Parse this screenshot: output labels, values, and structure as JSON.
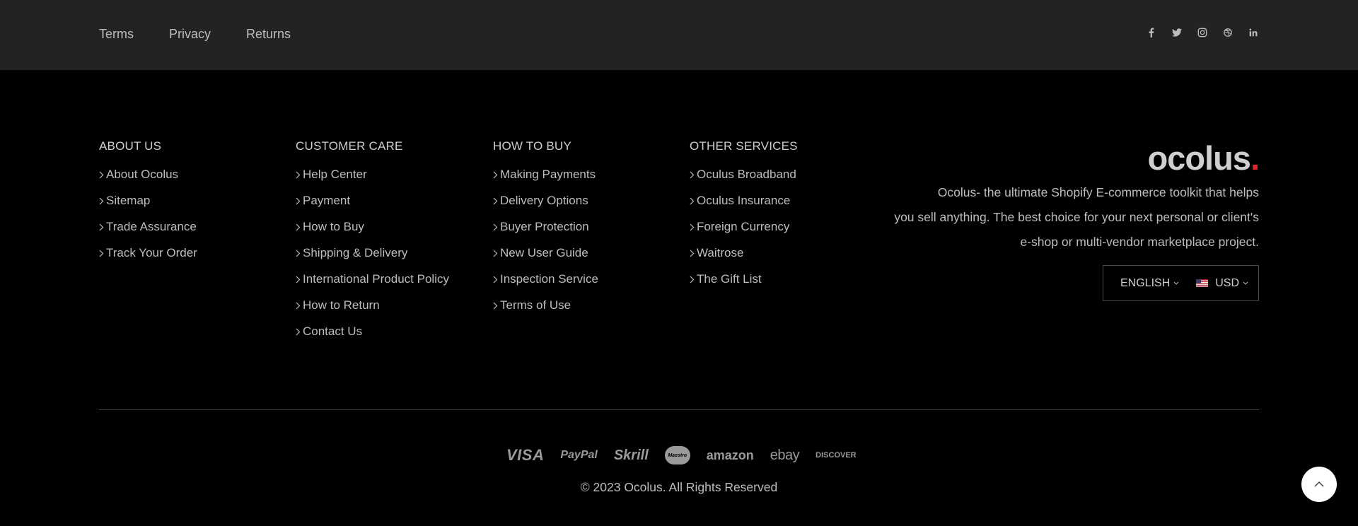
{
  "top_links": [
    "Terms",
    "Privacy",
    "Returns"
  ],
  "social_icons": [
    "facebook-icon",
    "twitter-icon",
    "instagram-icon",
    "dribbble-icon",
    "linkedin-icon"
  ],
  "columns": [
    {
      "heading": "ABOUT US",
      "items": [
        "About Ocolus",
        "Sitemap",
        "Trade Assurance",
        "Track Your Order"
      ]
    },
    {
      "heading": "CUSTOMER CARE",
      "items": [
        "Help Center",
        "Payment",
        "How to Buy",
        "Shipping & Delivery",
        "International Product Policy",
        "How to Return",
        "Contact Us"
      ]
    },
    {
      "heading": "HOW TO BUY",
      "items": [
        "Making Payments",
        "Delivery Options",
        "Buyer Protection",
        "New User Guide",
        "Inspection Service",
        "Terms of Use"
      ]
    },
    {
      "heading": "OTHER SERVICES",
      "items": [
        "Oculus Broadband",
        "Oculus Insurance",
        "Foreign Currency",
        "Waitrose",
        "The Gift List"
      ]
    }
  ],
  "brand": {
    "logo_text": "ocolus",
    "logo_dot": ".",
    "description_lines": [
      "Ocolus- the ultimate Shopify E-commerce toolkit that helps",
      "you sell anything. The best choice for your next personal or client's",
      "e-shop or multi-vendor marketplace project."
    ]
  },
  "selector": {
    "language": "ENGLISH",
    "currency": "USD"
  },
  "payment_methods": [
    "VISA",
    "PayPal",
    "Skrill",
    "Maestro",
    "amazon",
    "ebay",
    "DISCOVER"
  ],
  "copyright": "© 2023 Ocolus. All Rights Reserved",
  "colors": {
    "topbar_bg": "#232323",
    "page_bg": "#000000",
    "accent_red": "#e3262c"
  }
}
